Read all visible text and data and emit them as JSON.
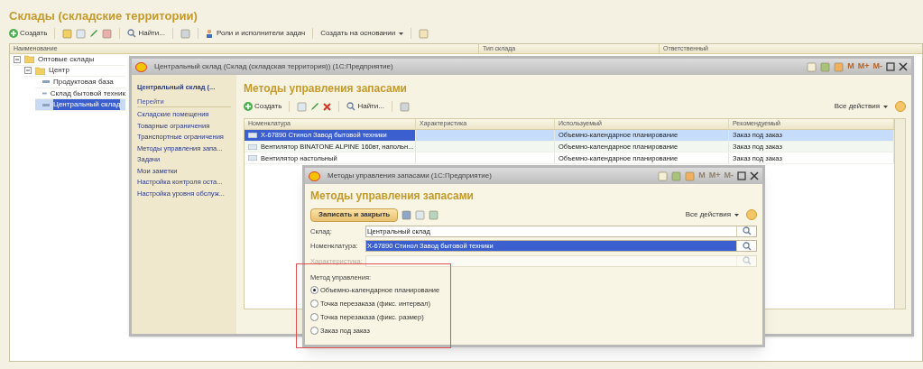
{
  "main": {
    "title": "Склады (складские территории)",
    "create_label": "Создать",
    "find_label": "Найти...",
    "roles_label": "Роли и исполнители задач",
    "based_on_label": "Создать на основании",
    "columns": [
      "Наименование",
      "Тип склада",
      "Ответственный"
    ],
    "rows": [
      {
        "name": "Оптовые склады",
        "kind": "folder",
        "expanded": true,
        "selected": false,
        "children": [
          {
            "name": "Центр",
            "kind": "folder",
            "expanded": true,
            "selected": false,
            "children": [
              {
                "name": "Продуктовая база",
                "kind": "item",
                "selected": false
              },
              {
                "name": "Склад бытовой техник",
                "kind": "item",
                "selected": false
              },
              {
                "name": "Центральный склад",
                "kind": "item",
                "selected": true
              }
            ]
          }
        ]
      }
    ]
  },
  "card_window": {
    "title": "Центральный склад (Склад (складская территория))  (1С:Предприятие)",
    "memory_buttons": [
      "M",
      "M+",
      "M-"
    ],
    "sidebar": {
      "header": "Центральный склад (...",
      "section": "Перейти",
      "links": [
        "Складские помещения",
        "Товарные ограничения",
        "Транспортные ограничения",
        "Методы управления запа...",
        "Задачи",
        "Мои заметки",
        "Настройка контроля оста...",
        "Настройка уровня обслуж..."
      ]
    },
    "heading": "Методы управления запасами",
    "create_label": "Создать",
    "find_label": "Найти...",
    "all_actions": "Все действия",
    "table": {
      "columns": [
        "Номенклатура",
        "Характеристика",
        "Используемый",
        "Рекомендуемый"
      ],
      "rows": [
        {
          "cells": [
            "X-67890 Стинол Завод бытовой техники",
            "",
            "Объемно-календарное планирование",
            "Заказ под заказ"
          ],
          "selected": true
        },
        {
          "cells": [
            "Вентилятор BINATONE ALPINE 160вт, напольн...",
            "",
            "Объемно-календарное планирование",
            "Заказ под заказ"
          ],
          "selected": false
        },
        {
          "cells": [
            "Вентилятор настольный",
            "",
            "Объемно-календарное планирование",
            "Заказ под заказ"
          ],
          "selected": false
        }
      ]
    }
  },
  "dialog": {
    "title": "Методы управления запасами  (1С:Предприятие)",
    "memory_buttons": [
      "M",
      "M+",
      "M-"
    ],
    "heading": "Методы управления запасами",
    "save_button": "Записать и закрыть",
    "all_actions": "Все действия",
    "fields": [
      {
        "label": "Склад:",
        "value": "Центральный склад",
        "disabled": false,
        "highlighted": false
      },
      {
        "label": "Номенклатура:",
        "value": "X-67890 Стинол Завод бытовой техники",
        "disabled": false,
        "highlighted": true
      },
      {
        "label": "Характеристика:",
        "disabled": true,
        "highlighted": false
      }
    ],
    "method": {
      "label": "Метод управления:",
      "options": [
        {
          "label": "Объемно-календарное планирование",
          "selected": true
        },
        {
          "label": "Точка перезаказа (фикс. интервал)",
          "selected": false
        },
        {
          "label": "Точка перезаказа (фикс. размер)",
          "selected": false
        },
        {
          "label": "Заказ под заказ",
          "selected": false
        }
      ]
    }
  }
}
